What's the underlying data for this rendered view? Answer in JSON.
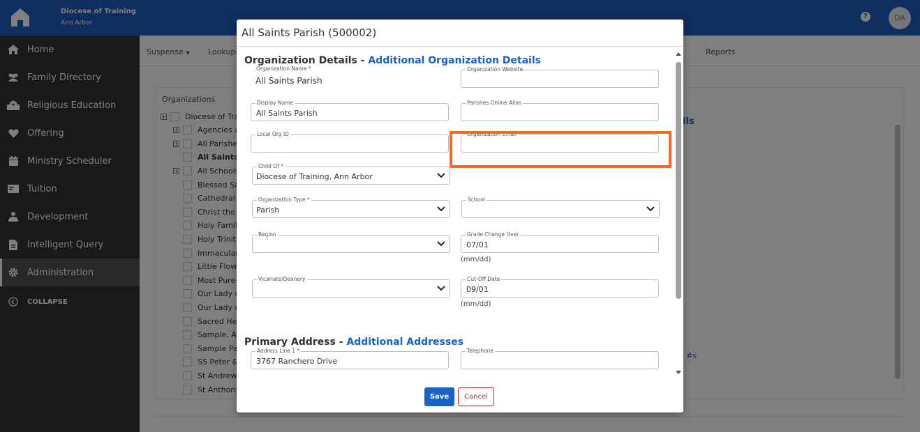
{
  "header": {
    "org_name": "Diocese of Training",
    "org_location": "Ann Arbor",
    "help_label": "?",
    "avatar_initials": "DA"
  },
  "sidebar": {
    "items": [
      {
        "label": "Home",
        "icon": "home-icon"
      },
      {
        "label": "Family Directory",
        "icon": "users-icon"
      },
      {
        "label": "Religious Education",
        "icon": "school-icon"
      },
      {
        "label": "Offering",
        "icon": "heart-icon"
      },
      {
        "label": "Ministry Scheduler",
        "icon": "calendar-icon"
      },
      {
        "label": "Tuition",
        "icon": "money-icon"
      },
      {
        "label": "Development",
        "icon": "sitemap-icon"
      },
      {
        "label": "Intelligent Query",
        "icon": "report-icon"
      },
      {
        "label": "Administration",
        "icon": "gear-icon",
        "active": true
      },
      {
        "label": "COLLAPSE",
        "icon": "chevron-left-circle-icon"
      }
    ]
  },
  "subnav": {
    "items": [
      "Suspense",
      "Lookups",
      "Reports"
    ]
  },
  "organizations": {
    "title": "Organizations",
    "tree": [
      "Diocese of Trai",
      "Agencies a",
      "All Parishes",
      "All Saints",
      "All Schools",
      "Blessed Sa",
      "Cathedral o",
      "Christ the K",
      "Holy Family",
      "Holy Trinity",
      "Immaculate",
      "Little Flowe",
      "Most Pure H",
      "Our Lady o",
      "Our Lady o",
      "Sacred Hea",
      "Sample, An",
      "Sample Par",
      "SS Peter &",
      "St Andrew",
      "St Anthony"
    ],
    "right_link_1": "ils",
    "right_link_2": "#s"
  },
  "modal": {
    "title": "All Saints Parish (500002)",
    "section1": {
      "title": "Organization Details - ",
      "link": "Additional Organization Details"
    },
    "section2": {
      "title": "Primary Address - ",
      "link": "Additional Addresses"
    },
    "fields": {
      "org_name": {
        "label": "Organization Name",
        "value": "All Saints Parish"
      },
      "org_website": {
        "label": "Organization Website",
        "value": ""
      },
      "display_name": {
        "label": "Display Name",
        "value": "All Saints Parish"
      },
      "parishes_alias": {
        "label": "Parishes Online Alias",
        "value": ""
      },
      "local_org_id": {
        "label": "Local Org ID",
        "value": ""
      },
      "org_email": {
        "label": "Organization Email",
        "value": ""
      },
      "child_of": {
        "label": "Child Of",
        "value": "Diocese of Training, Ann Arbor"
      },
      "org_type": {
        "label": "Organization Type",
        "value": "Parish"
      },
      "school": {
        "label": "School",
        "value": ""
      },
      "region": {
        "label": "Region",
        "value": ""
      },
      "grade_change": {
        "label": "Grade Change Over",
        "value": "07/01",
        "hint": "(mm/dd)"
      },
      "vicariate": {
        "label": "Vicariate/Deanery",
        "value": ""
      },
      "cutoff": {
        "label": "Cut-Off Date",
        "value": "09/01",
        "hint": "(mm/dd)"
      },
      "address1": {
        "label": "Address Line 1",
        "value": "3767 Ranchero Drive"
      },
      "telephone": {
        "label": "Telephone",
        "value": ""
      }
    },
    "required_mark": "*",
    "save_label": "Save",
    "cancel_label": "Cancel"
  },
  "colors": {
    "header_bg": "#1f5cc1",
    "accent": "#1a63c6",
    "highlight": "#f36b21",
    "cancel": "#c62828"
  }
}
